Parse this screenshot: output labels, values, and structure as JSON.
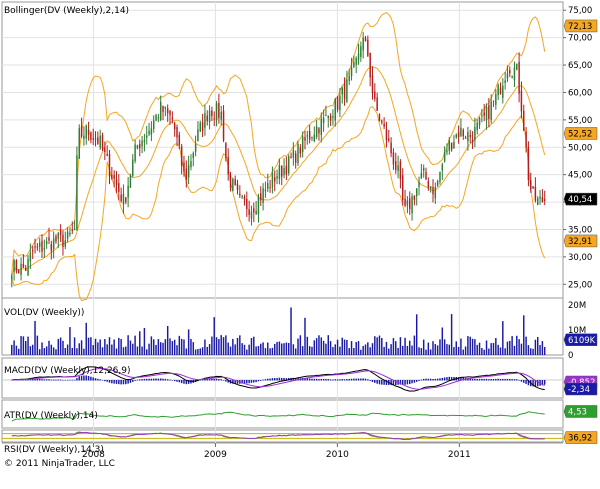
{
  "chart_data": {
    "type": "candlestick",
    "x_axis": {
      "labels": [
        "2008",
        "2009",
        "2010",
        "2011"
      ],
      "label_years": [
        2008,
        2009,
        2010,
        2011
      ],
      "range": [
        2007.25,
        2011.85
      ]
    },
    "copyright": "© 2011 NinjaTrader, LLC",
    "panels": {
      "price": {
        "title": "Bollinger(DV (Weekly),2,14)",
        "ylim": [
          22.5,
          76.5
        ],
        "ticks": [
          "75,00",
          "70,00",
          "65,00",
          "60,00",
          "55,00",
          "50,00",
          "45,00",
          "40,00",
          "35,00",
          "30,00",
          "25,00"
        ],
        "tick_values": [
          75,
          70,
          65,
          60,
          55,
          50,
          45,
          40,
          35,
          30,
          25
        ],
        "markers": [
          {
            "label": "72,13",
            "value": 72.13,
            "fill": "#f5a623",
            "text": "#000000"
          },
          {
            "label": "52,52",
            "value": 52.52,
            "fill": "#f5a623",
            "text": "#000000"
          },
          {
            "label": "40,54",
            "value": 40.54,
            "fill": "#000000",
            "text": "#ffffff"
          },
          {
            "label": "32,91",
            "value": 32.91,
            "fill": "#f5a623",
            "text": "#000000"
          }
        ],
        "colors": {
          "up": "#2e7d32",
          "down": "#b71c1c",
          "band": "#f5a623"
        },
        "anchors": [
          [
            2007.25,
            29
          ],
          [
            2007.35,
            28
          ],
          [
            2007.45,
            28
          ],
          [
            2007.5,
            31
          ],
          [
            2007.6,
            32
          ],
          [
            2007.7,
            33
          ],
          [
            2007.78,
            33
          ],
          [
            2007.85,
            35
          ],
          [
            2007.87,
            52
          ],
          [
            2007.95,
            53
          ],
          [
            2008.05,
            51
          ],
          [
            2008.15,
            45
          ],
          [
            2008.25,
            40
          ],
          [
            2008.35,
            50
          ],
          [
            2008.45,
            53
          ],
          [
            2008.55,
            57
          ],
          [
            2008.65,
            55
          ],
          [
            2008.75,
            44
          ],
          [
            2008.85,
            52
          ],
          [
            2008.95,
            57
          ],
          [
            2009.05,
            56
          ],
          [
            2009.1,
            45
          ],
          [
            2009.2,
            40
          ],
          [
            2009.3,
            39
          ],
          [
            2009.4,
            42
          ],
          [
            2009.5,
            45
          ],
          [
            2009.6,
            47
          ],
          [
            2009.7,
            50
          ],
          [
            2009.8,
            53
          ],
          [
            2009.9,
            55
          ],
          [
            2010.0,
            58
          ],
          [
            2010.1,
            62
          ],
          [
            2010.15,
            65
          ],
          [
            2010.2,
            70
          ],
          [
            2010.25,
            67
          ],
          [
            2010.3,
            58
          ],
          [
            2010.4,
            52
          ],
          [
            2010.5,
            45
          ],
          [
            2010.55,
            38
          ],
          [
            2010.6,
            40
          ],
          [
            2010.7,
            45
          ],
          [
            2010.8,
            42
          ],
          [
            2010.9,
            50
          ],
          [
            2011.0,
            53
          ],
          [
            2011.1,
            52
          ],
          [
            2011.2,
            55
          ],
          [
            2011.3,
            59
          ],
          [
            2011.4,
            65
          ],
          [
            2011.47,
            64
          ],
          [
            2011.52,
            56
          ],
          [
            2011.57,
            44
          ],
          [
            2011.6,
            41
          ],
          [
            2011.65,
            40
          ],
          [
            2011.7,
            40.5
          ]
        ]
      },
      "volume": {
        "title": "VOL(DV (Weekly))",
        "ticks": [
          "20M",
          "10M",
          "0"
        ],
        "tick_values": [
          20,
          10,
          0
        ],
        "ylim": [
          0,
          22
        ],
        "marker": {
          "label": "6109K",
          "value": 6.1,
          "fill": "#1a1aa6",
          "text": "#ffffff"
        },
        "color": "#1a1aa6"
      },
      "macd": {
        "title": "MACD(DV (Weekly),12,26,9)",
        "markers": [
          {
            "label": "-0,852",
            "value": -0.852,
            "fill": "#9b30d9",
            "text": "#ffffff"
          },
          {
            "label": "-2,34",
            "value": -2.34,
            "fill": "#1a1aa6",
            "text": "#ffffff"
          }
        ],
        "colors": {
          "macd": "#000000",
          "signal": "#9b30d9",
          "hist": "#1a1aa6"
        }
      },
      "atr": {
        "title": "ATR(DV (Weekly),14)",
        "marker": {
          "label": "4,53",
          "value": 4.53,
          "fill": "#2e9e2e",
          "text": "#ffffff"
        },
        "color": "#2e9e2e"
      },
      "rsi": {
        "title": "RSI(DV (Weekly),14,3)",
        "marker": {
          "label": "36,92",
          "value": 36.92,
          "fill": "#f5a623",
          "text": "#000000"
        },
        "colors": {
          "rsi": "#6b8e23",
          "avg": "#9b30d9",
          "levels": "#c8b400"
        }
      }
    }
  }
}
